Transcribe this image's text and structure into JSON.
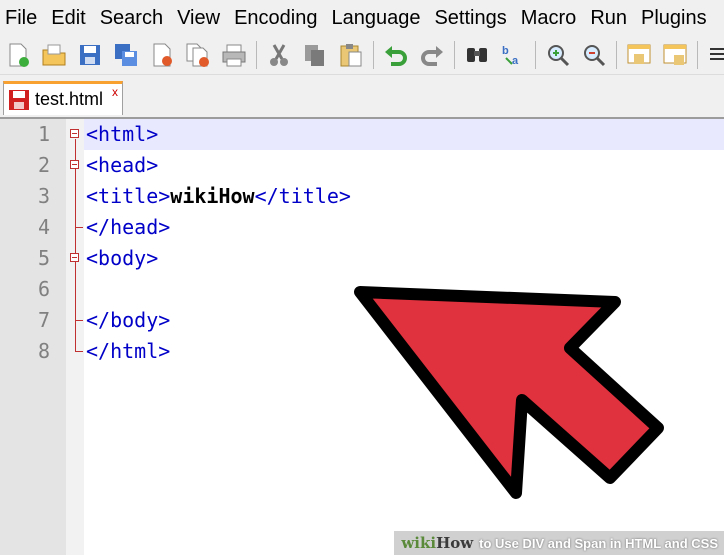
{
  "menu": [
    "File",
    "Edit",
    "Search",
    "View",
    "Encoding",
    "Language",
    "Settings",
    "Macro",
    "Run",
    "Plugins"
  ],
  "toolbar": {
    "icons": [
      "new-file-icon",
      "open-file-icon",
      "save-icon",
      "save-all-icon",
      "close-icon",
      "close-all-icon",
      "print-icon",
      "cut-icon",
      "copy-icon",
      "paste-icon",
      "undo-icon",
      "redo-icon",
      "find-icon",
      "replace-icon",
      "zoom-in-icon",
      "zoom-out-icon",
      "sync-vertical-icon",
      "sync-horizontal-icon",
      "word-wrap-icon"
    ]
  },
  "tab": {
    "label": "test.html",
    "close": "x"
  },
  "editor": {
    "line_numbers": [
      "1",
      "2",
      "3",
      "4",
      "5",
      "6",
      "7",
      "8"
    ],
    "lines": [
      [
        "<html>"
      ],
      [
        "<head>"
      ],
      [
        "<title>",
        "wikiHow",
        "</title>"
      ],
      [
        "</head>"
      ],
      [
        "<body>"
      ],
      [
        ""
      ],
      [
        "</body>"
      ],
      [
        "</html>"
      ]
    ]
  },
  "watermark": {
    "wiki": "wiki",
    "how": "How",
    "text": "to Use DIV and Span in HTML and CSS"
  },
  "colors": {
    "tag": "#0000c8",
    "arrow": "#e0313e",
    "tab_accent": "#f8a030"
  }
}
